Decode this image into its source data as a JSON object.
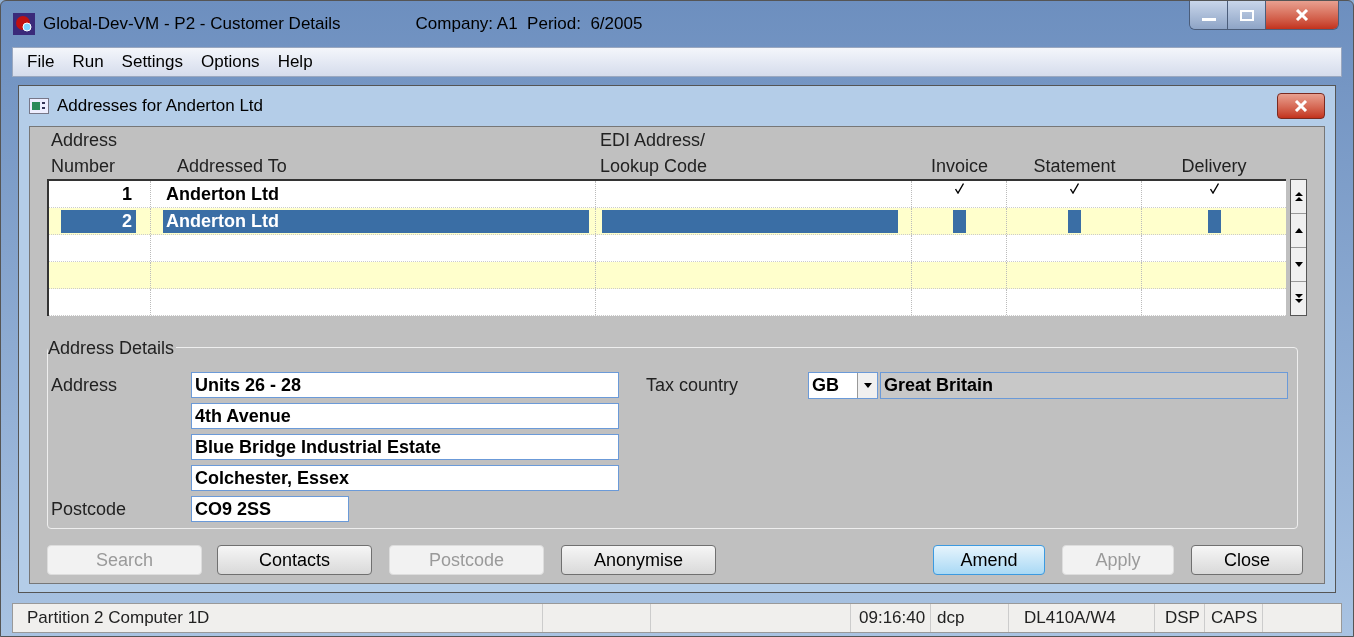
{
  "window": {
    "title": "Global-Dev-VM - P2 - Customer Details",
    "context": "Company: A1  Period:  6/2005"
  },
  "menu": [
    "File",
    "Run",
    "Settings",
    "Options",
    "Help"
  ],
  "dialog": {
    "title": "Addresses for Anderton Ltd"
  },
  "table": {
    "columns": [
      {
        "line1": "Address",
        "line2": "Number"
      },
      {
        "line2": "Addressed To"
      },
      {
        "line1": "EDI Address/",
        "line2": "Lookup Code"
      },
      {
        "line2": "Invoice"
      },
      {
        "line2": "Statement"
      },
      {
        "line2": "Delivery"
      }
    ],
    "rows": [
      {
        "number": "1",
        "addressed_to": "Anderton Ltd",
        "invoice": true,
        "statement": true,
        "delivery": true,
        "selected": false
      },
      {
        "number": "2",
        "addressed_to": "Anderton Ltd",
        "invoice": false,
        "statement": false,
        "delivery": false,
        "selected": true
      }
    ]
  },
  "address_details": {
    "title": "Address Details",
    "address_label": "Address",
    "address_lines": [
      "Units 26 - 28",
      "4th Avenue",
      "Blue Bridge Industrial Estate",
      "Colchester, Essex"
    ],
    "postcode_label": "Postcode",
    "postcode": "CO9 2SS",
    "tax_country_label": "Tax country",
    "tax_country_code": "GB",
    "tax_country_name": "Great Britain"
  },
  "buttons": [
    {
      "label": "Search",
      "disabled": true,
      "default": false
    },
    {
      "label": "Contacts",
      "disabled": false,
      "default": false
    },
    {
      "label": "Postcode",
      "disabled": true,
      "default": false
    },
    {
      "label": "Anonymise",
      "disabled": false,
      "default": false
    },
    {
      "label": "Amend",
      "disabled": false,
      "default": true
    },
    {
      "label": "Apply",
      "disabled": true,
      "default": false
    },
    {
      "label": "Close",
      "disabled": false,
      "default": false
    }
  ],
  "status_bar": [
    "Partition 2 Computer 1D",
    "09:16:40",
    "dcp",
    "DL410A/W4",
    "DSP",
    "CAPS"
  ]
}
